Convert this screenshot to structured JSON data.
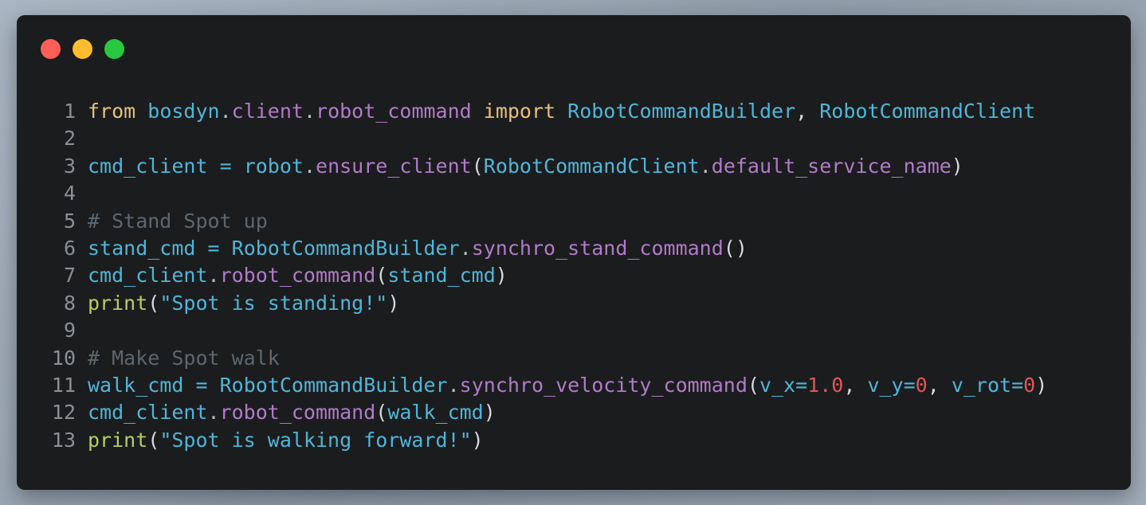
{
  "window": {
    "buttons": [
      {
        "name": "close",
        "color": "#ff5f57"
      },
      {
        "name": "minimize",
        "color": "#febc2e"
      },
      {
        "name": "maximize",
        "color": "#28c840"
      }
    ]
  },
  "code": {
    "lines": [
      {
        "num": "1",
        "tokens": [
          {
            "t": "from",
            "c": "kw"
          },
          {
            "t": " ",
            "c": "punc"
          },
          {
            "t": "bosdyn",
            "c": "mod"
          },
          {
            "t": ".",
            "c": "dot"
          },
          {
            "t": "client",
            "c": "attr"
          },
          {
            "t": ".",
            "c": "dot"
          },
          {
            "t": "robot_command",
            "c": "attr"
          },
          {
            "t": " ",
            "c": "punc"
          },
          {
            "t": "import",
            "c": "kw"
          },
          {
            "t": " ",
            "c": "punc"
          },
          {
            "t": "RobotCommandBuilder",
            "c": "cls"
          },
          {
            "t": ", ",
            "c": "punc"
          },
          {
            "t": "RobotCommandClient",
            "c": "cls"
          }
        ]
      },
      {
        "num": "2",
        "tokens": []
      },
      {
        "num": "3",
        "tokens": [
          {
            "t": "cmd_client",
            "c": "var"
          },
          {
            "t": " ",
            "c": "punc"
          },
          {
            "t": "=",
            "c": "op"
          },
          {
            "t": " ",
            "c": "punc"
          },
          {
            "t": "robot",
            "c": "var"
          },
          {
            "t": ".",
            "c": "dot"
          },
          {
            "t": "ensure_client",
            "c": "fn"
          },
          {
            "t": "(",
            "c": "paren"
          },
          {
            "t": "RobotCommandClient",
            "c": "cls"
          },
          {
            "t": ".",
            "c": "dot"
          },
          {
            "t": "default_service_name",
            "c": "attr"
          },
          {
            "t": ")",
            "c": "paren"
          }
        ]
      },
      {
        "num": "4",
        "tokens": []
      },
      {
        "num": "5",
        "tokens": [
          {
            "t": "# Stand Spot up",
            "c": "cm"
          }
        ]
      },
      {
        "num": "6",
        "tokens": [
          {
            "t": "stand_cmd",
            "c": "var"
          },
          {
            "t": " ",
            "c": "punc"
          },
          {
            "t": "=",
            "c": "op"
          },
          {
            "t": " ",
            "c": "punc"
          },
          {
            "t": "RobotCommandBuilder",
            "c": "cls"
          },
          {
            "t": ".",
            "c": "dot"
          },
          {
            "t": "synchro_stand_command",
            "c": "fn"
          },
          {
            "t": "()",
            "c": "paren"
          }
        ]
      },
      {
        "num": "7",
        "tokens": [
          {
            "t": "cmd_client",
            "c": "var"
          },
          {
            "t": ".",
            "c": "dot"
          },
          {
            "t": "robot_command",
            "c": "fn"
          },
          {
            "t": "(",
            "c": "paren"
          },
          {
            "t": "stand_cmd",
            "c": "var"
          },
          {
            "t": ")",
            "c": "paren"
          }
        ]
      },
      {
        "num": "8",
        "tokens": [
          {
            "t": "print",
            "c": "builtin"
          },
          {
            "t": "(",
            "c": "paren"
          },
          {
            "t": "\"Spot is standing!\"",
            "c": "str"
          },
          {
            "t": ")",
            "c": "paren"
          }
        ]
      },
      {
        "num": "9",
        "tokens": []
      },
      {
        "num": "10",
        "tokens": [
          {
            "t": "# Make Spot walk",
            "c": "cm"
          }
        ]
      },
      {
        "num": "11",
        "tokens": [
          {
            "t": "walk_cmd",
            "c": "var"
          },
          {
            "t": " ",
            "c": "punc"
          },
          {
            "t": "=",
            "c": "op"
          },
          {
            "t": " ",
            "c": "punc"
          },
          {
            "t": "RobotCommandBuilder",
            "c": "cls"
          },
          {
            "t": ".",
            "c": "dot"
          },
          {
            "t": "synchro_velocity_command",
            "c": "fn"
          },
          {
            "t": "(",
            "c": "paren"
          },
          {
            "t": "v_x",
            "c": "var"
          },
          {
            "t": "=",
            "c": "op"
          },
          {
            "t": "1.0",
            "c": "num"
          },
          {
            "t": ", ",
            "c": "punc"
          },
          {
            "t": "v_y",
            "c": "var"
          },
          {
            "t": "=",
            "c": "op"
          },
          {
            "t": "0",
            "c": "num"
          },
          {
            "t": ", ",
            "c": "punc"
          },
          {
            "t": "v_rot",
            "c": "var"
          },
          {
            "t": "=",
            "c": "op"
          },
          {
            "t": "0",
            "c": "num"
          },
          {
            "t": ")",
            "c": "paren"
          }
        ]
      },
      {
        "num": "12",
        "tokens": [
          {
            "t": "cmd_client",
            "c": "var"
          },
          {
            "t": ".",
            "c": "dot"
          },
          {
            "t": "robot_command",
            "c": "fn"
          },
          {
            "t": "(",
            "c": "paren"
          },
          {
            "t": "walk_cmd",
            "c": "var"
          },
          {
            "t": ")",
            "c": "paren"
          }
        ]
      },
      {
        "num": "13",
        "tokens": [
          {
            "t": "print",
            "c": "builtin"
          },
          {
            "t": "(",
            "c": "paren"
          },
          {
            "t": "\"Spot is walking forward!\"",
            "c": "str"
          },
          {
            "t": ")",
            "c": "paren"
          }
        ]
      }
    ]
  }
}
